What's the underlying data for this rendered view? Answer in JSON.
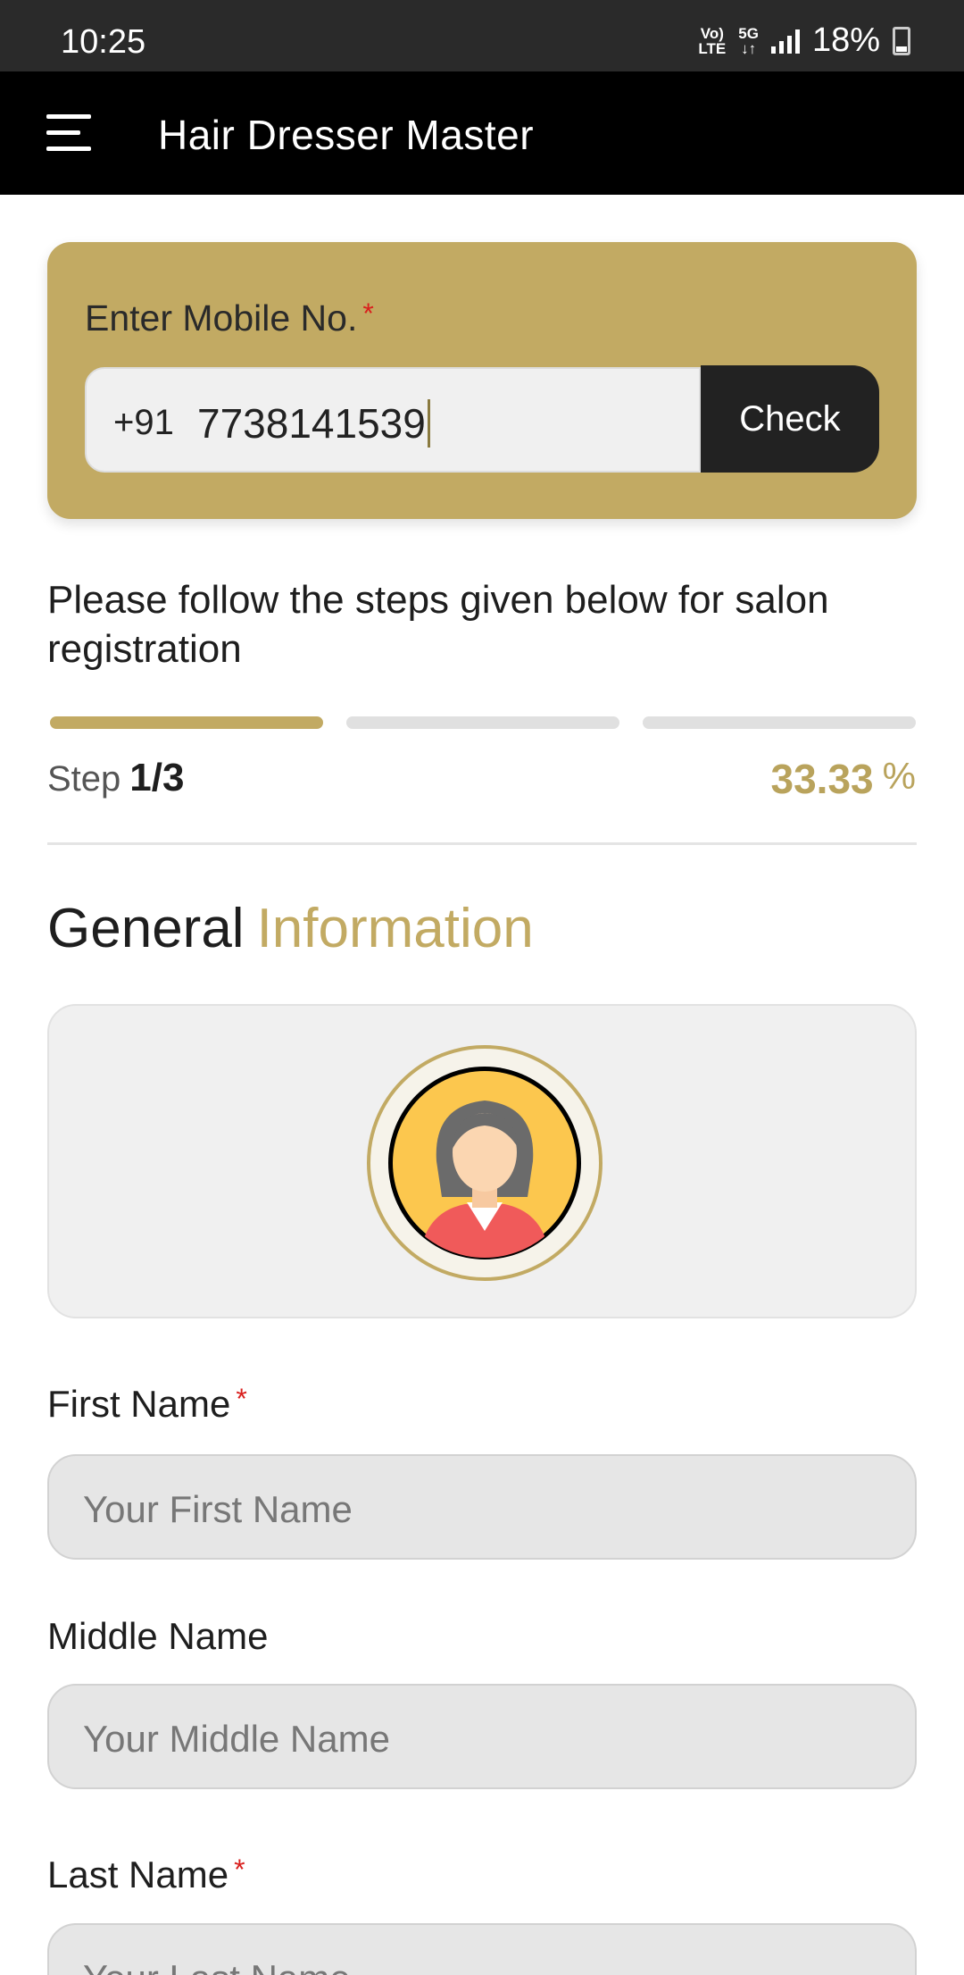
{
  "status_bar": {
    "time": "10:25",
    "volte_top": "Vo)",
    "volte_bottom": "LTE",
    "network_top": "5G",
    "network_bottom": "↓↑",
    "battery_text": "18%"
  },
  "app_bar": {
    "title": "Hair Dresser Master",
    "menu_icon": "menu-icon"
  },
  "mobile_check": {
    "label": "Enter Mobile No.",
    "required_mark": "*",
    "country_code": "+91",
    "phone_value": "7738141539",
    "check_label": "Check"
  },
  "instructions": "Please follow the steps given below for salon registration",
  "progress": {
    "total_steps": 3,
    "current_step": 1,
    "step_word": "Step",
    "step_text": "1/3",
    "percent_text": "33.33",
    "percent_sign": "%",
    "active_color": "#c2aa63",
    "inactive_color": "#e0e0e0"
  },
  "section": {
    "title_part1": "General",
    "title_part2": "Information"
  },
  "photo": {
    "icon": "female-avatar-icon"
  },
  "fields": {
    "first_name": {
      "label": "First Name",
      "required_mark": "*",
      "placeholder": "Your First Name"
    },
    "middle_name": {
      "label": "Middle Name",
      "placeholder": "Your Middle Name"
    },
    "last_name": {
      "label": "Last Name",
      "required_mark": "*",
      "placeholder": "Your Last Name"
    }
  },
  "colors": {
    "accent": "#c2aa63",
    "header": "#000000",
    "button": "#222222",
    "required": "#d9201e"
  }
}
